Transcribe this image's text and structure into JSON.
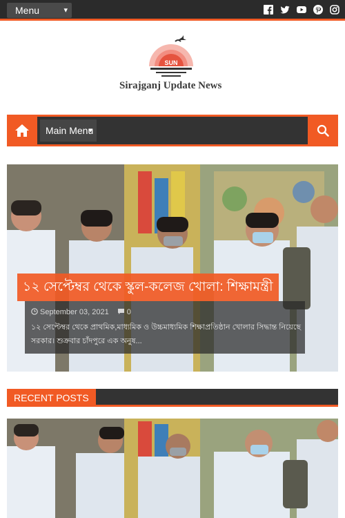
{
  "topbar": {
    "menu_label": "Menu",
    "socials": [
      "facebook-icon",
      "twitter-icon",
      "youtube-icon",
      "pinterest-icon",
      "instagram-icon"
    ]
  },
  "site": {
    "logo_text": "SUN",
    "title": "Sirajganj Update News"
  },
  "nav": {
    "main_menu_label": "Main Menu"
  },
  "featured": {
    "title": "১২ সেপ্টেম্বর থেকে স্কুল-কলেজ খোলা: শিক্ষামন্ত্রী",
    "date": "September 03, 2021",
    "comments": "0",
    "excerpt": "১২ সেপ্টেম্বর থেকে প্রাথমিক,মাধ্যমিক ও উচ্চমাধ্যমিক শিক্ষাপ্রতিষ্ঠান খোলার সিদ্ধান্ত নিয়েছে সরকার। শুক্রবার চাঁদপুরে এক অনুষ..."
  },
  "recent": {
    "section_title": "RECENT POSTS"
  },
  "colors": {
    "accent": "#f15a24",
    "dark": "#333333"
  }
}
